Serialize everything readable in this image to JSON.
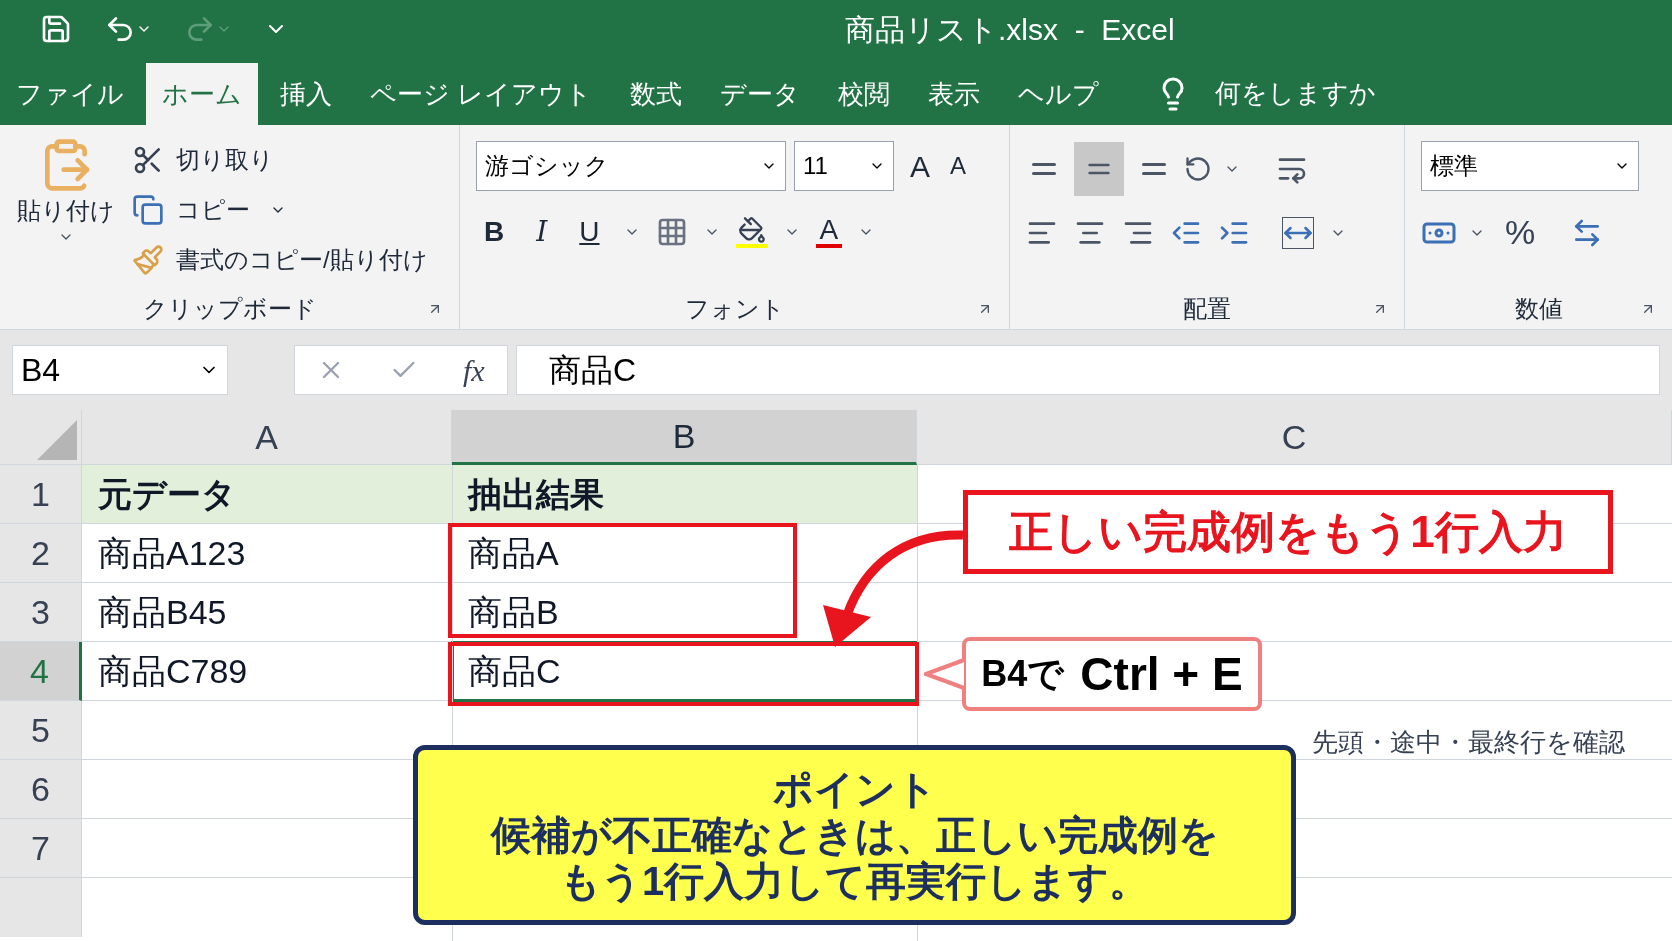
{
  "window": {
    "title": "商品リスト.xlsx  -  Excel"
  },
  "tabs": [
    {
      "label": "ファイル",
      "selected": false
    },
    {
      "label": "ホーム",
      "selected": true
    },
    {
      "label": "挿入",
      "selected": false
    },
    {
      "label": "ページ レイアウト",
      "selected": false
    },
    {
      "label": "数式",
      "selected": false
    },
    {
      "label": "データ",
      "selected": false
    },
    {
      "label": "校閲",
      "selected": false
    },
    {
      "label": "表示",
      "selected": false
    },
    {
      "label": "ヘルプ",
      "selected": false
    }
  ],
  "tell_me": "何をしますか",
  "ribbon": {
    "clipboard": {
      "label": "クリップボード",
      "paste": "貼り付け",
      "cut": "切り取り",
      "copy": "コピー",
      "format_painter": "書式のコピー/貼り付け"
    },
    "font": {
      "label": "フォント",
      "font_name": "游ゴシック",
      "font_size": "11",
      "grow": "A",
      "shrink": "A",
      "bold": "B",
      "italic": "I",
      "underline": "U",
      "font_color": "A"
    },
    "alignment": {
      "label": "配置",
      "middle_align_selected": true
    },
    "number": {
      "label": "数値",
      "format": "標準",
      "percent": "%"
    }
  },
  "formula_bar": {
    "name_box": "B4",
    "fx": "fx",
    "value": "商品C"
  },
  "columns": [
    {
      "label": "A",
      "selected": false
    },
    {
      "label": "B",
      "selected": true
    },
    {
      "label": "C",
      "selected": false
    }
  ],
  "rows": [
    {
      "header": "1",
      "selected": false,
      "kind": "heading",
      "cells": [
        "元データ",
        "抽出結果"
      ]
    },
    {
      "header": "2",
      "selected": false,
      "kind": "data",
      "cells": [
        "商品A123",
        "商品A"
      ]
    },
    {
      "header": "3",
      "selected": false,
      "kind": "data",
      "cells": [
        "商品B45",
        "商品B"
      ]
    },
    {
      "header": "4",
      "selected": true,
      "kind": "data",
      "cells": [
        "商品C789",
        "商品C"
      ]
    },
    {
      "header": "5",
      "selected": false,
      "kind": "data"
    },
    {
      "header": "6",
      "selected": false,
      "kind": "data"
    },
    {
      "header": "7",
      "selected": false,
      "kind": "data"
    }
  ],
  "annotations": {
    "callout": "正しい完成例をもう1行入力",
    "shortcut": [
      "B4で",
      "Ctrl + E"
    ],
    "note": "先頭・途中・最終行を確認",
    "tip": {
      "title": "ポイント",
      "lines": [
        "候補が不正確なときは、正しい完成例を",
        "もう1行入力して再実行します。"
      ]
    }
  }
}
